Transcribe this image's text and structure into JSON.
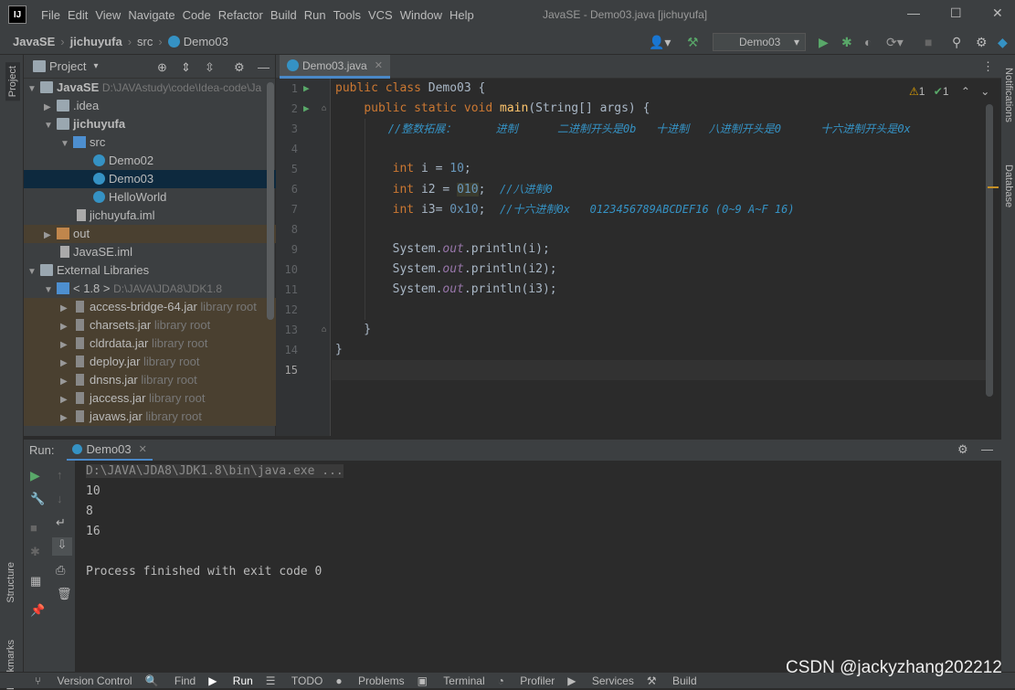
{
  "app": {
    "window_title": "JavaSE - Demo03.java [jichuyufa]",
    "menu": [
      "File",
      "Edit",
      "View",
      "Navigate",
      "Code",
      "Refactor",
      "Build",
      "Run",
      "Tools",
      "VCS",
      "Window",
      "Help"
    ]
  },
  "breadcrumb": [
    "JavaSE",
    "jichuyufa",
    "src",
    "Demo03"
  ],
  "toolbar": {
    "run_config": "Demo03"
  },
  "left_tabs": {
    "project": "Project",
    "structure": "Structure",
    "bookmarks": "Bookmarks"
  },
  "right_tabs": {
    "notifications": "Notifications",
    "database": "Database"
  },
  "project_panel": {
    "title": "Project",
    "tree": [
      {
        "label": "JavaSE",
        "hint": "D:\\JAVAstudy\\code\\Idea-code\\Ja"
      },
      {
        "label": ".idea",
        "hint": ""
      },
      {
        "label": "jichuyufa",
        "hint": ""
      },
      {
        "label": "src",
        "hint": ""
      },
      {
        "label": "Demo02",
        "hint": ""
      },
      {
        "label": "Demo03",
        "hint": ""
      },
      {
        "label": "HelloWorld",
        "hint": ""
      },
      {
        "label": "jichuyufa.iml",
        "hint": ""
      },
      {
        "label": "out",
        "hint": ""
      },
      {
        "label": "JavaSE.iml",
        "hint": ""
      },
      {
        "label": "External Libraries",
        "hint": ""
      },
      {
        "label": "< 1.8 >",
        "hint": "D:\\JAVA\\JDA8\\JDK1.8"
      },
      {
        "label": "access-bridge-64.jar",
        "hint": "library root"
      },
      {
        "label": "charsets.jar",
        "hint": "library root"
      },
      {
        "label": "cldrdata.jar",
        "hint": "library root"
      },
      {
        "label": "deploy.jar",
        "hint": "library root"
      },
      {
        "label": "dnsns.jar",
        "hint": "library root"
      },
      {
        "label": "jaccess.jar",
        "hint": "library root"
      },
      {
        "label": "javaws.jar",
        "hint": "library root"
      }
    ]
  },
  "editor": {
    "tab": "Demo03.java",
    "inspections": {
      "warnings": "1",
      "ok": "1"
    },
    "line_numbers": [
      "1",
      "2",
      "3",
      "4",
      "5",
      "6",
      "7",
      "8",
      "9",
      "10",
      "11",
      "12",
      "13",
      "14",
      "15"
    ],
    "lines": [
      "public class Demo03 {",
      "    public static void main(String[] args) {",
      "        //整数拓展：      进制      二进制开头是0b   十进制   八进制开头是0      十六进制开头是0x",
      "",
      "        int i = 10;",
      "        int i2 = 010;  //八进制0",
      "        int i3= 0x10;  //十六进制0x   0123456789ABCDEF16 (0~9 A~F 16)",
      "",
      "        System.out.println(i);",
      "        System.out.println(i2);",
      "        System.out.println(i3);",
      "",
      "    }",
      "}",
      ""
    ]
  },
  "run_panel": {
    "label": "Run:",
    "tab": "Demo03",
    "output": [
      "D:\\JAVA\\JDA8\\JDK1.8\\bin\\java.exe ...",
      "10",
      "8",
      "16",
      "",
      "Process finished with exit code 0"
    ]
  },
  "status_bar": [
    "Version Control",
    "Find",
    "Run",
    "TODO",
    "Problems",
    "Terminal",
    "Profiler",
    "Services",
    "Build"
  ],
  "watermark": "CSDN @jackyzhang202212"
}
